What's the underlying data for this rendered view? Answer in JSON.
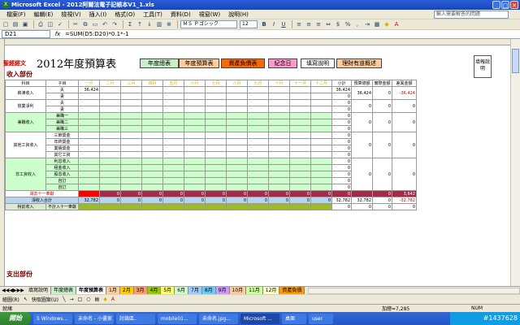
{
  "window": {
    "title": "Microsoft Excel - 2012阿爾法電子記帳本V1_1.xls",
    "controls": [
      "_",
      "□",
      "✕"
    ]
  },
  "menu": {
    "items": [
      "檔案(F)",
      "編輯(E)",
      "檢視(V)",
      "插入(I)",
      "格式(O)",
      "工具(T)",
      "資料(D)",
      "視窗(W)",
      "說明(H)"
    ],
    "help_placeholder": "輸入需要解答的問題"
  },
  "toolbar": {
    "font": "ＭＳ Ｐゴシック",
    "size": "12"
  },
  "formula_bar": {
    "cell": "D21",
    "fx": "fx",
    "formula": "=SUM(D5:D20)*0.1*-1"
  },
  "sheet": {
    "stamp": "聖經經文",
    "title": "2012年度預算表",
    "buttons": [
      {
        "label": "年度總表",
        "color": "#c8f0c8"
      },
      {
        "label": "年度預算表",
        "color": "#ffcc99"
      },
      {
        "label": "資產負債表",
        "color": "#ff6600"
      },
      {
        "label": "紀念日",
        "color": "#ff99cc"
      },
      {
        "label": "填寫說明",
        "color": "#ffffff"
      },
      {
        "label": "理財有道概述",
        "color": "#ffcc99"
      }
    ],
    "note": "填報說明",
    "income_section": "收入部份",
    "expense_section": "支出部份",
    "headers": [
      "科目",
      "子目",
      "一月",
      "二月",
      "三月",
      "四月",
      "五月",
      "六月",
      "七月",
      "八月",
      "九月",
      "十月",
      "十一月",
      "十二月",
      "小計",
      "預算總額",
      "實際金額",
      "差異金額"
    ],
    "rows": [
      {
        "cat": "薪津收入",
        "sub": "夫",
        "m": [
          "36,424",
          "",
          "",
          "",
          "",
          "",
          "",
          "",
          "",
          "",
          "",
          ""
        ],
        "total": "36,424",
        "budget": "36,424",
        "actual": "0",
        "diff": "-36,424",
        "g": false
      },
      {
        "cat": "",
        "sub": "妻",
        "m": [
          "",
          "",
          "",
          "",
          "",
          "",
          "",
          "",
          "",
          "",
          "",
          ""
        ],
        "total": "0",
        "budget": "",
        "actual": "",
        "diff": "",
        "g": false
      },
      {
        "cat": "營業淨利",
        "sub": "夫",
        "m": [
          "",
          "",
          "",
          "",
          "",
          "",
          "",
          "",
          "",
          "",
          "",
          ""
        ],
        "total": "0",
        "budget": "0",
        "actual": "0",
        "diff": "0",
        "g": false
      },
      {
        "cat": "",
        "sub": "妻",
        "m": [
          "",
          "",
          "",
          "",
          "",
          "",
          "",
          "",
          "",
          "",
          "",
          ""
        ],
        "total": "0",
        "budget": "",
        "actual": "",
        "diff": "",
        "g": false
      },
      {
        "cat": "兼職收入",
        "sub": "兼職一",
        "m": [
          "",
          "",
          "",
          "",
          "",
          "",
          "",
          "",
          "",
          "",
          "",
          ""
        ],
        "total": "0",
        "budget": "0",
        "actual": "0",
        "diff": "0",
        "g": true
      },
      {
        "cat": "",
        "sub": "兼職二",
        "m": [
          "",
          "",
          "",
          "",
          "",
          "",
          "",
          "",
          "",
          "",
          "",
          ""
        ],
        "total": "0",
        "budget": "",
        "actual": "",
        "diff": "",
        "g": true
      },
      {
        "cat": "",
        "sub": "兼職三",
        "m": [
          "",
          "",
          "",
          "",
          "",
          "",
          "",
          "",
          "",
          "",
          "",
          ""
        ],
        "total": "0",
        "budget": "",
        "actual": "",
        "diff": "",
        "g": true
      },
      {
        "cat": "其他工資收入",
        "sub": "三節獎金",
        "m": [
          "",
          "",
          "",
          "",
          "",
          "",
          "",
          "",
          "",
          "",
          "",
          ""
        ],
        "total": "0",
        "budget": "0",
        "actual": "0",
        "diff": "0",
        "g": false
      },
      {
        "cat": "",
        "sub": "年終獎金",
        "m": [
          "",
          "",
          "",
          "",
          "",
          "",
          "",
          "",
          "",
          "",
          "",
          ""
        ],
        "total": "0",
        "budget": "",
        "actual": "",
        "diff": "",
        "g": false
      },
      {
        "cat": "",
        "sub": "業績獎金",
        "m": [
          "",
          "",
          "",
          "",
          "",
          "",
          "",
          "",
          "",
          "",
          "",
          ""
        ],
        "total": "0",
        "budget": "",
        "actual": "",
        "diff": "",
        "g": false
      },
      {
        "cat": "",
        "sub": "其它工資",
        "m": [
          "",
          "",
          "",
          "",
          "",
          "",
          "",
          "",
          "",
          "",
          "",
          ""
        ],
        "total": "0",
        "budget": "",
        "actual": "",
        "diff": "",
        "g": false
      },
      {
        "cat": "非工資收入",
        "sub": "利息收入",
        "m": [
          "",
          "",
          "",
          "",
          "",
          "",
          "",
          "",
          "",
          "",
          "",
          ""
        ],
        "total": "0",
        "budget": "0",
        "actual": "0",
        "diff": "0",
        "g": true
      },
      {
        "cat": "",
        "sub": "租金收入",
        "m": [
          "",
          "",
          "",
          "",
          "",
          "",
          "",
          "",
          "",
          "",
          "",
          ""
        ],
        "total": "0",
        "budget": "",
        "actual": "",
        "diff": "",
        "g": true
      },
      {
        "cat": "",
        "sub": "股息收入",
        "m": [
          "",
          "",
          "",
          "",
          "",
          "",
          "",
          "",
          "",
          "",
          "",
          ""
        ],
        "total": "0",
        "budget": "",
        "actual": "",
        "diff": "",
        "g": true
      },
      {
        "cat": "",
        "sub": "自訂",
        "m": [
          "",
          "",
          "",
          "",
          "",
          "",
          "",
          "",
          "",
          "",
          "",
          ""
        ],
        "total": "0",
        "budget": "",
        "actual": "",
        "diff": "",
        "g": true
      },
      {
        "cat": "",
        "sub": "自訂",
        "m": [
          "",
          "",
          "",
          "",
          "",
          "",
          "",
          "",
          "",
          "",
          "",
          ""
        ],
        "total": "0",
        "budget": "",
        "actual": "",
        "diff": "",
        "g": true
      }
    ],
    "tithe_row": {
      "label": "減去十一奉獻",
      "m": [
        "",
        "0",
        "0",
        "0",
        "0",
        "0",
        "0",
        "0",
        "0",
        "0",
        "0",
        "0"
      ],
      "total": "0",
      "budget": "",
      "actual": "0",
      "diff": "3,642"
    },
    "net_row": {
      "label": "淨收入合計",
      "m": [
        "32,782",
        "0",
        "0",
        "0",
        "0",
        "0",
        "0",
        "0",
        "0",
        "0",
        "0",
        "0"
      ],
      "total": "32,782",
      "budget": "32,782",
      "actual": "0",
      "diff": "-32,782"
    },
    "pretithe_row": {
      "label": "稅前收入",
      "sub": "不計入十一奉獻",
      "total": "0",
      "budget": "0",
      "actual": "0",
      "diff": "0"
    }
  },
  "tabs": [
    "填寫說明",
    "年度總表",
    "年度預算表",
    "1月",
    "2月",
    "3月",
    "4月",
    "5月",
    "6月",
    "7月",
    "8月",
    "9月",
    "10月",
    "11月",
    "12月",
    "資產負債"
  ],
  "drawbar": [
    "繪圖(R)",
    "快取圖案(U)"
  ],
  "status": {
    "ready": "就緒",
    "sum": "加總=7,285",
    "num": "NUM"
  },
  "taskbar": {
    "start": "開始",
    "items": [
      "5 Windows...",
      "未命名 - 小畫家",
      "討論區..",
      "mobile01...",
      "未命名.jpg...",
      "Microsoft ...",
      "桌面",
      "user"
    ],
    "tray": "#1437628"
  }
}
